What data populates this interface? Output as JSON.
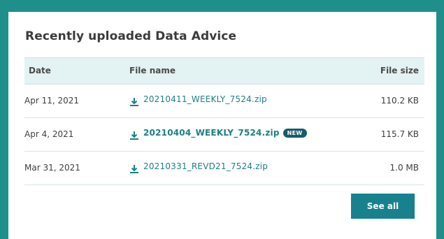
{
  "panel": {
    "title": "Recently uploaded Data Advice"
  },
  "table": {
    "headers": {
      "date": "Date",
      "file_name": "File name",
      "file_size": "File size"
    },
    "rows": [
      {
        "date": "Apr 11, 2021",
        "file_name": "20210411_WEEKLY_7524.zip",
        "file_size": "110.2 KB",
        "badge": ""
      },
      {
        "date": "Apr 4, 2021",
        "file_name": "20210404_WEEKLY_7524.zip",
        "file_size": "115.7 KB",
        "badge": "NEW"
      },
      {
        "date": "Mar 31, 2021",
        "file_name": "20210331_REVD21_7524.zip",
        "file_size": "1.0 MB",
        "badge": ""
      }
    ]
  },
  "actions": {
    "see_all_label": "See all"
  },
  "colors": {
    "frame": "#1f8f8c",
    "link": "#1b7f86",
    "badge": "#155c6b",
    "button": "#17828d",
    "header_bg": "#e3f2f2"
  },
  "icons": {
    "file_action": "download-icon"
  }
}
